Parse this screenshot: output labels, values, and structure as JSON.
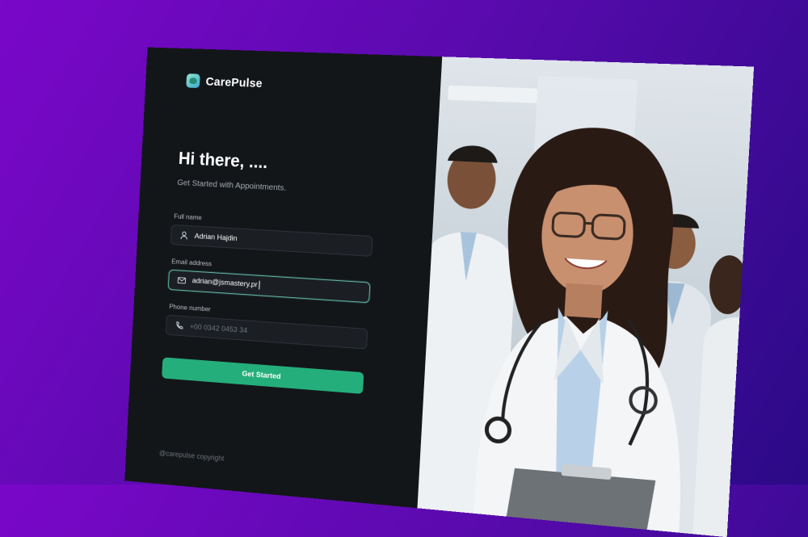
{
  "brand": {
    "name": "CarePulse"
  },
  "form": {
    "greeting": "Hi there, ....",
    "subtitle": "Get Started with Appointments.",
    "fields": [
      {
        "label": "Full name",
        "value": "Adrian Hajdin",
        "icon": "user-icon"
      },
      {
        "label": "Email address",
        "value": "adrian@jsmastery.pr",
        "icon": "mail-icon"
      },
      {
        "label": "Phone number",
        "placeholder": "+00 0342 0453 34",
        "icon": "phone-icon"
      }
    ],
    "submit_label": "Get Started"
  },
  "footer": {
    "copyright": "@carepulse copyright"
  },
  "colors": {
    "accent": "#24ae7c",
    "panel": "#131619",
    "focus": "#5fb5a5"
  }
}
